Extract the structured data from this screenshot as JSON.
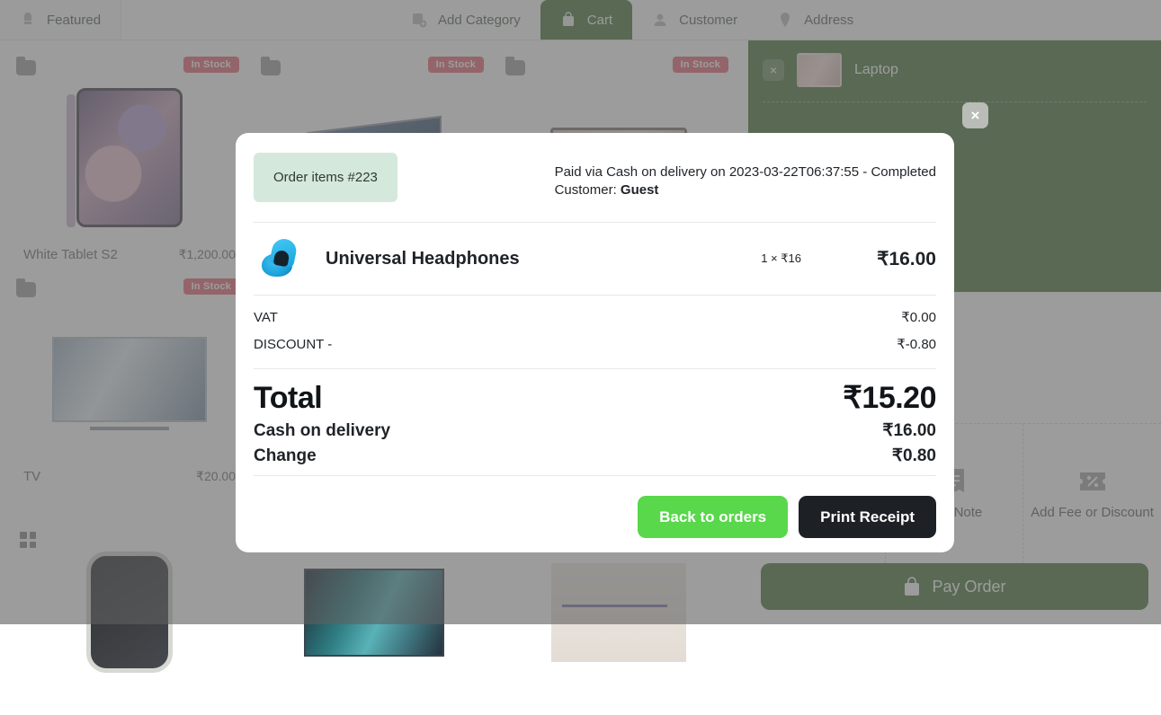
{
  "topnav": {
    "tabs": [
      {
        "label": "Featured",
        "icon": "pin-icon",
        "active": false
      },
      {
        "label": "Add Category",
        "icon": "add-category-icon",
        "active": false
      },
      {
        "label": "Cart",
        "icon": "cart-icon",
        "active": true
      },
      {
        "label": "Customer",
        "icon": "customer-icon",
        "active": false
      },
      {
        "label": "Address",
        "icon": "address-icon",
        "active": false
      }
    ]
  },
  "products": [
    {
      "name": "White Tablet S2",
      "price": "₹1,200.00",
      "stock": "In Stock"
    },
    {
      "name": "",
      "price": "",
      "stock": "In Stock"
    },
    {
      "name": "",
      "price": "",
      "stock": "In Stock"
    },
    {
      "name": "TV",
      "price": "₹20.00",
      "stock": "In Stock"
    }
  ],
  "cart": {
    "item_name": "Laptop",
    "close_label": "×",
    "actions": [
      {
        "label": "",
        "icon": "user-icon"
      },
      {
        "label": "Add Note",
        "icon": "note-icon"
      },
      {
        "label": "Add Fee or Discount",
        "icon": "discount-tag-icon"
      }
    ],
    "pay_order_label": "Pay Order"
  },
  "modal": {
    "close_label": "×",
    "order_badge": "Order items #223",
    "paid_line": "Paid via Cash on delivery on 2023-03-22T06:37:55 - Completed",
    "customer_label": "Customer:",
    "customer_value": "Guest",
    "item": {
      "name": "Universal Headphones",
      "qty_price": "1 × ₹16",
      "line_total": "₹16.00",
      "thumb_icon": "headphones-case-icon"
    },
    "fees": [
      {
        "label": "VAT",
        "value": "₹0.00"
      },
      {
        "label": "DISCOUNT -",
        "value": "₹-0.80"
      }
    ],
    "total": {
      "label": "Total",
      "value": "₹15.20"
    },
    "payments": [
      {
        "label": "Cash on delivery",
        "value": "₹16.00"
      },
      {
        "label": "Change",
        "value": "₹0.80"
      }
    ],
    "buttons": {
      "back": "Back to orders",
      "print": "Print Receipt"
    }
  },
  "colors": {
    "accent_green": "#4f7a42",
    "button_green": "#58d84a",
    "button_dark": "#1d2125",
    "badge_mint": "#d5e8dc",
    "stock_red": "#e8707d"
  }
}
